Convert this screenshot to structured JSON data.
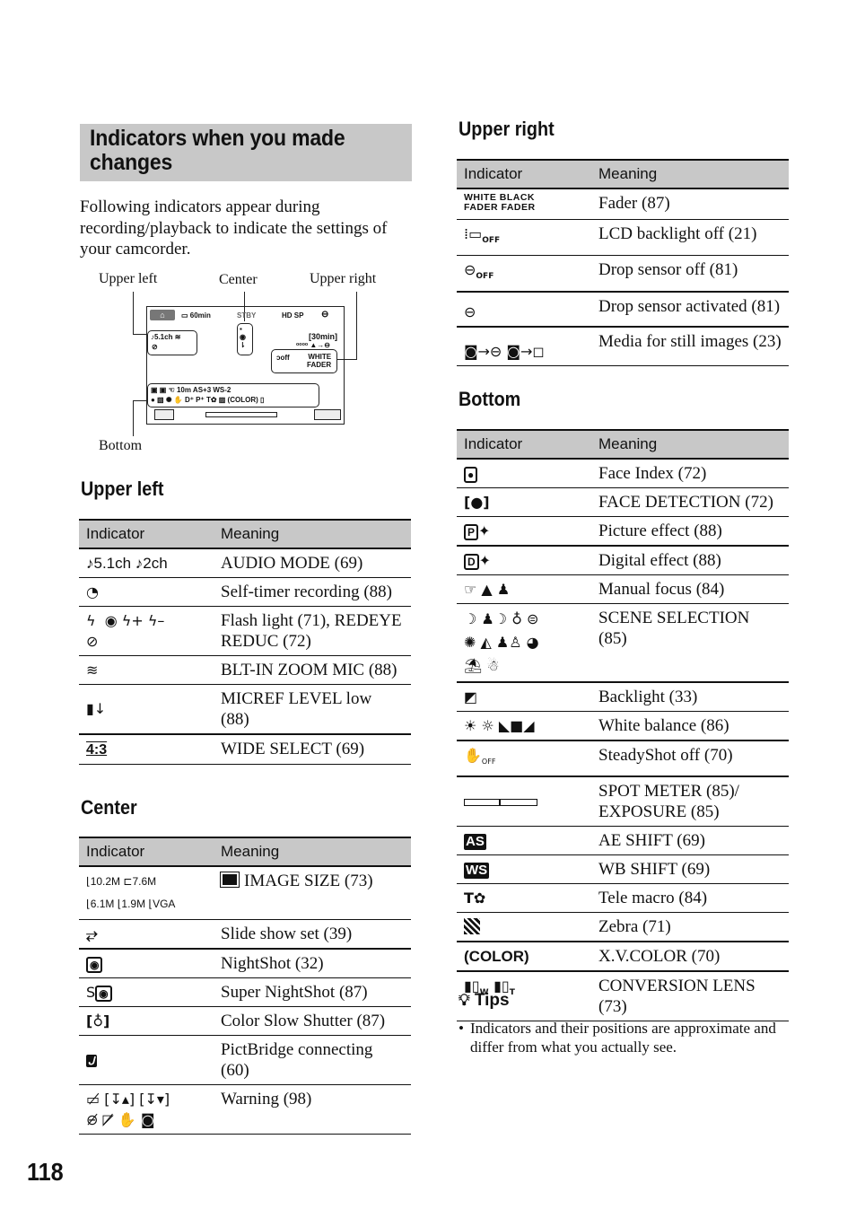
{
  "page": {
    "title": "Indicators when you made changes",
    "intro": "Following indicators appear during recording/playback to indicate the settings of your camcorder.",
    "page_number": "118"
  },
  "diagram": {
    "labels": {
      "upper_left": "Upper left",
      "center": "Center",
      "upper_right": "Upper right",
      "bottom": "Bottom"
    },
    "screen": {
      "battery": "60min",
      "status": "STBY",
      "quality": "HD SP",
      "audio": "♪5.1ch",
      "remaining": "[30min]",
      "fader": [
        "WHITE",
        "FADER"
      ],
      "bottom_row1": "10m",
      "ae_shift": "+3",
      "wb_shift": "-2",
      "xv_color": "(COLOR)"
    }
  },
  "columns": {
    "indicator": "Indicator",
    "meaning": "Meaning"
  },
  "sections": {
    "upper_left": {
      "title": "Upper left",
      "rows": [
        {
          "icons": "♪5.1ch ♪2ch",
          "meaning": "AUDIO MODE (69)"
        },
        {
          "icons": "self-timer-icon",
          "meaning": "Self-timer recording (88)"
        },
        {
          "icons": "flash-icons",
          "meaning": "Flash light (71), REDEYE REDUC (72)"
        },
        {
          "icons": "zoom-mic-icon",
          "meaning": "BLT-IN ZOOM MIC (88)"
        },
        {
          "icons": "mic-level-low-icon",
          "meaning": "MICREF LEVEL low (88)"
        },
        {
          "icons": "4:3",
          "meaning": "WIDE SELECT (69)"
        }
      ]
    },
    "center": {
      "title": "Center",
      "rows": [
        {
          "icons": [
            "10.2M",
            "7.6M",
            "6.1M",
            "1.9M",
            "VGA"
          ],
          "meaning": "IMAGE SIZE (73)"
        },
        {
          "icons": "slide-show-icon",
          "meaning": "Slide show set (39)"
        },
        {
          "icons": "nightshot-icon",
          "meaning": "NightShot (32)"
        },
        {
          "icons": "super-nightshot-icon",
          "meaning": "Super NightShot (87)"
        },
        {
          "icons": "color-slow-shutter-icon",
          "meaning": "Color Slow Shutter (87)"
        },
        {
          "icons": "pictbridge-icon",
          "meaning": "PictBridge connecting (60)"
        },
        {
          "icons": "warning-icons",
          "meaning": "Warning (98)"
        }
      ]
    },
    "upper_right": {
      "title": "Upper right",
      "rows": [
        {
          "icons": [
            "WHITE FADER",
            "BLACK FADER"
          ],
          "meaning": "Fader (87)"
        },
        {
          "icons": "lcd-backlight-off-icon",
          "meaning": "LCD backlight off (21)"
        },
        {
          "icons": "drop-sensor-off-icon",
          "meaning": "Drop sensor off (81)"
        },
        {
          "icons": "drop-sensor-activated-icon",
          "meaning": "Drop sensor activated (81)"
        },
        {
          "icons": "media-still-images-icons",
          "meaning": "Media for still images (23)"
        }
      ]
    },
    "bottom": {
      "title": "Bottom",
      "rows": [
        {
          "icons": "face-index-icon",
          "meaning": "Face Index (72)"
        },
        {
          "icons": "face-detection-icon",
          "meaning": "FACE DETECTION (72)"
        },
        {
          "icons": "picture-effect-icon",
          "meaning": "Picture effect (88)"
        },
        {
          "icons": "digital-effect-icon",
          "meaning": "Digital effect (88)"
        },
        {
          "icons": "manual-focus-icons",
          "meaning": "Manual focus (84)"
        },
        {
          "icons": "scene-selection-icons",
          "meaning": "SCENE SELECTION (85)"
        },
        {
          "icons": "backlight-icon",
          "meaning": "Backlight (33)"
        },
        {
          "icons": "white-balance-icons",
          "meaning": "White balance (86)"
        },
        {
          "icons": "steadyshot-off-icon",
          "meaning": "SteadyShot off (70)"
        },
        {
          "icons": "exposure-bar-icon",
          "meaning": "SPOT METER (85)/ EXPOSURE (85)"
        },
        {
          "icons": "AS",
          "meaning": "AE SHIFT (69)"
        },
        {
          "icons": "WS",
          "meaning": "WB SHIFT (69)"
        },
        {
          "icons": "tele-macro-icon",
          "meaning": "Tele macro (84)"
        },
        {
          "icons": "zebra-icon",
          "meaning": "Zebra (71)"
        },
        {
          "icons": "(COLOR)",
          "meaning": "X.V.COLOR (70)"
        },
        {
          "icons": "conversion-lens-icons",
          "meaning": "CONVERSION LENS (73)"
        }
      ]
    }
  },
  "tips": {
    "title": "Tips",
    "items": [
      "Indicators and their positions are approximate and differ from what you actually see."
    ]
  }
}
